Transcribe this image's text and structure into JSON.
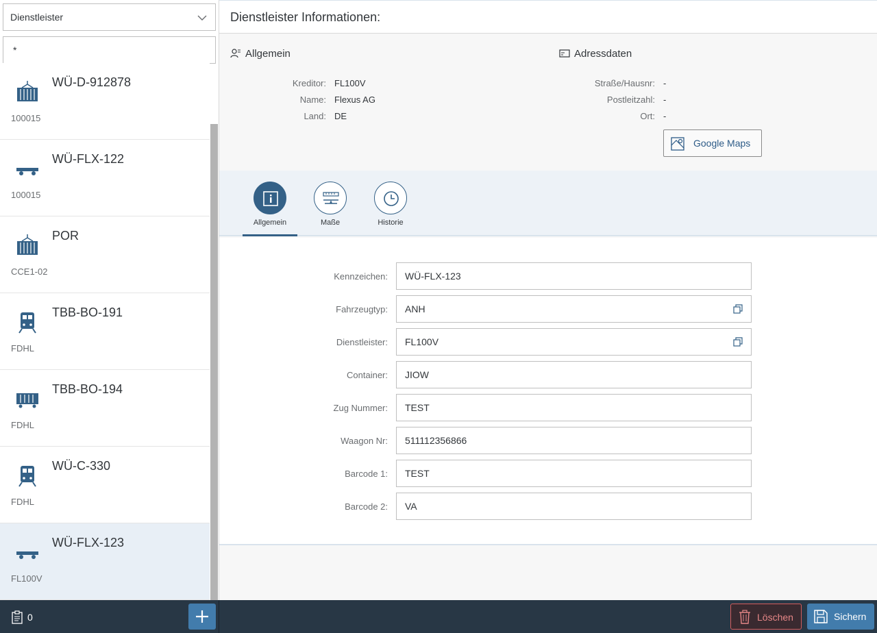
{
  "master": {
    "filter_select": "Dienstleister",
    "search_value": "*",
    "items": [
      {
        "title": "WÜ-D-912878",
        "subtitle": "100015",
        "icon": "container-icon"
      },
      {
        "title": "WÜ-FLX-122",
        "subtitle": "100015",
        "icon": "trailer-icon"
      },
      {
        "title": "POR",
        "subtitle": "CCE1-02",
        "icon": "container-icon"
      },
      {
        "title": "TBB-BO-191",
        "subtitle": "FDHL",
        "icon": "train-icon"
      },
      {
        "title": "TBB-BO-194",
        "subtitle": "FDHL",
        "icon": "wagon-icon"
      },
      {
        "title": "WÜ-C-330",
        "subtitle": "FDHL",
        "icon": "train-icon"
      },
      {
        "title": "WÜ-FLX-123",
        "subtitle": "FL100V",
        "icon": "trailer-icon",
        "selected": true
      }
    ]
  },
  "detail": {
    "header_title": "Dienstleister Informationen:",
    "general_section": {
      "title": "Allgemein",
      "fields": [
        {
          "label": "Kreditor:",
          "value": "FL100V"
        },
        {
          "label": "Name:",
          "value": "Flexus AG"
        },
        {
          "label": "Land:",
          "value": "DE"
        }
      ]
    },
    "address_section": {
      "title": "Adressdaten",
      "fields": [
        {
          "label": "Straße/Hausnr:",
          "value": "-"
        },
        {
          "label": "Postleitzahl:",
          "value": "-"
        },
        {
          "label": "Ort:",
          "value": "-"
        }
      ],
      "maps_button": "Google Maps"
    },
    "tabs": [
      {
        "label": "Allgemein",
        "icon": "info-icon",
        "active": true
      },
      {
        "label": "Maße",
        "icon": "ruler-icon"
      },
      {
        "label": "Historie",
        "icon": "clock-icon"
      }
    ],
    "form": [
      {
        "label": "Kennzeichen:",
        "value": "WÜ-FLX-123"
      },
      {
        "label": "Fahrzeugtyp:",
        "value": "ANH",
        "value_help": true
      },
      {
        "label": "Dienstleister:",
        "value": "FL100V",
        "value_help": true
      },
      {
        "label": "Container:",
        "value": "JIOW"
      },
      {
        "label": "Zug Nummer:",
        "value": "TEST"
      },
      {
        "label": "Waagon Nr:",
        "value": "511112356866"
      },
      {
        "label": "Barcode 1:",
        "value": "TEST"
      },
      {
        "label": "Barcode 2:",
        "value": "VA"
      }
    ]
  },
  "footer": {
    "count": "0",
    "delete_label": "Löschen",
    "save_label": "Sichern"
  },
  "colors": {
    "accent": "#427cac",
    "accent_dark": "#346187",
    "footer_bg": "#283745",
    "delete": "#e68787"
  }
}
